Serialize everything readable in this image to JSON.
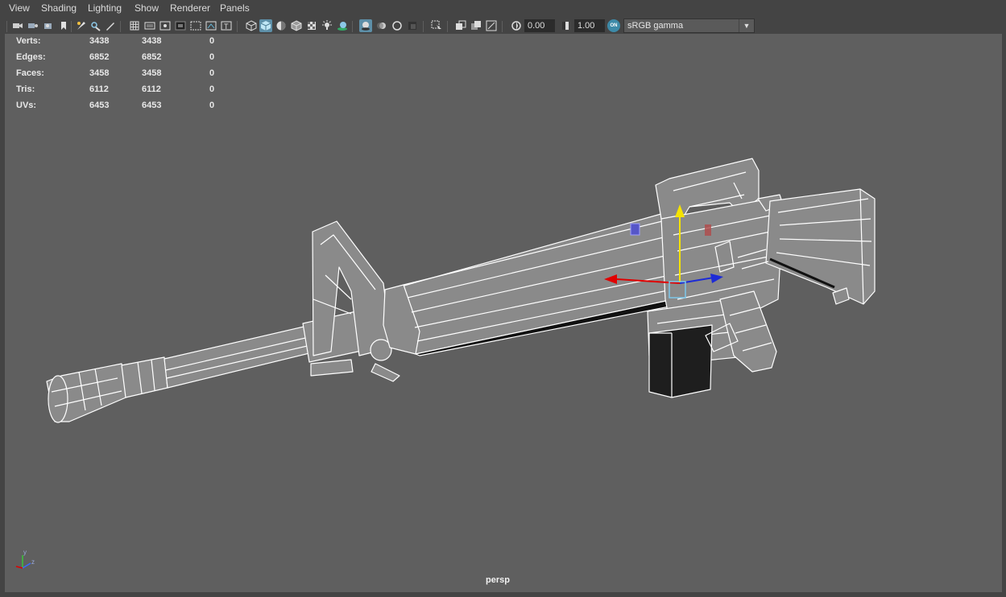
{
  "menubar": {
    "items": [
      "View",
      "Shading",
      "Lighting",
      "Show",
      "Renderer",
      "Panels"
    ]
  },
  "toolbar": {
    "icons": [
      "select-camera-icon",
      "camera-attributes-icon",
      "bookmarks-icon",
      "image-plane-icon",
      "2d-pan-zoom-icon",
      "grease-pencil-icon",
      "grid-icon",
      "film-gate-icon",
      "resolution-gate-icon",
      "gate-mask-icon",
      "field-chart-icon",
      "safe-action-icon",
      "safe-title-icon",
      "wireframe-icon",
      "smooth-shade-icon",
      "default-material-icon",
      "wireframe-on-shaded-icon",
      "textured-icon",
      "use-all-lights-icon",
      "shadows-icon",
      "screen-space-ao-icon",
      "motion-blur-icon",
      "multisample-aa-icon",
      "depth-of-field-icon",
      "isolate-select-icon",
      "xray-icon",
      "xray-active-components-icon",
      "xray-joints-icon",
      "backface-culling-icon",
      "exposure-icon",
      "gamma-icon",
      "color-management-icon"
    ],
    "exposure_value": "0.00",
    "gamma_value": "1.00",
    "colorspace": "sRGB gamma",
    "color_management_toggle": "ON"
  },
  "hud": {
    "rows": [
      {
        "label": "Verts:",
        "v1": "3438",
        "v2": "3438",
        "v3": "0"
      },
      {
        "label": "Edges:",
        "v1": "6852",
        "v2": "6852",
        "v3": "0"
      },
      {
        "label": "Faces:",
        "v1": "3458",
        "v2": "3458",
        "v3": "0"
      },
      {
        "label": "Tris:",
        "v1": "6112",
        "v2": "6112",
        "v3": "0"
      },
      {
        "label": "UVs:",
        "v1": "6453",
        "v2": "6453",
        "v3": "0"
      }
    ]
  },
  "viewport": {
    "camera": "persp",
    "background_color": "#5f5f5f",
    "axis_labels": {
      "y": "y",
      "z": "z"
    }
  },
  "colors": {
    "wire": "#ffffff",
    "shade": "#8a8a8a",
    "axis_x": "#e00000",
    "axis_y": "#f5e300",
    "axis_z": "#1d2bd6",
    "active_toggle": "#5d8fa8"
  }
}
